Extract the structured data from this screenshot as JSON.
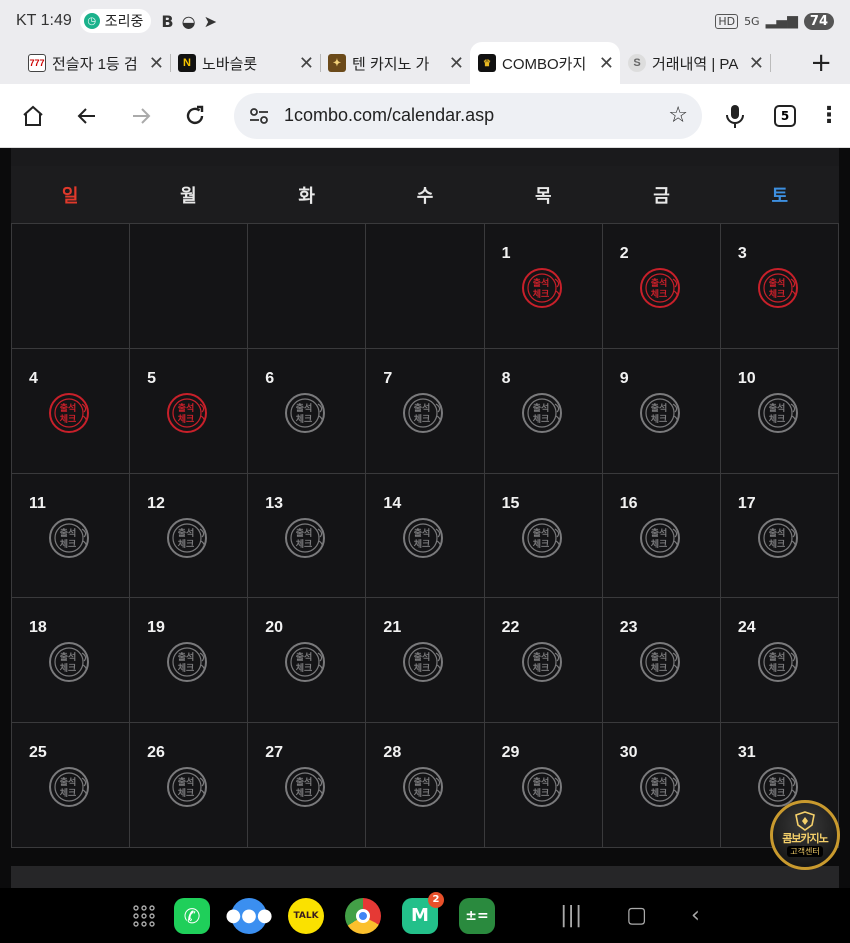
{
  "status_bar": {
    "carrier_time": "KT 1:49",
    "pill_label": "조리중",
    "battery": "74",
    "hd": "HD",
    "network": "5G"
  },
  "tabs": [
    {
      "title": "전슬자 1등 검",
      "icon": "slot-machine-icon"
    },
    {
      "title": "노바슬롯",
      "icon": "n-logo-icon"
    },
    {
      "title": "텐 카지노 가",
      "icon": "casino-chips-icon"
    },
    {
      "title": "COMBO카지",
      "icon": "combo-logo-icon",
      "active": true
    },
    {
      "title": "거래내역 | PA",
      "icon": "page-icon"
    }
  ],
  "address_bar": {
    "url": "1combo.com/calendar.asp",
    "tab_count": "5"
  },
  "calendar": {
    "weekdays": [
      "일",
      "월",
      "화",
      "수",
      "목",
      "금",
      "토"
    ],
    "stamp_text_top": "출석",
    "stamp_text_bottom": "체크",
    "days": [
      {
        "day": "",
        "status": "none"
      },
      {
        "day": "",
        "status": "none"
      },
      {
        "day": "",
        "status": "none"
      },
      {
        "day": "",
        "status": "none"
      },
      {
        "day": "1",
        "status": "checked"
      },
      {
        "day": "2",
        "status": "checked"
      },
      {
        "day": "3",
        "status": "checked"
      },
      {
        "day": "4",
        "status": "checked"
      },
      {
        "day": "5",
        "status": "checked"
      },
      {
        "day": "6",
        "status": "pending"
      },
      {
        "day": "7",
        "status": "pending"
      },
      {
        "day": "8",
        "status": "pending"
      },
      {
        "day": "9",
        "status": "pending"
      },
      {
        "day": "10",
        "status": "pending"
      },
      {
        "day": "11",
        "status": "pending"
      },
      {
        "day": "12",
        "status": "pending"
      },
      {
        "day": "13",
        "status": "pending"
      },
      {
        "day": "14",
        "status": "pending"
      },
      {
        "day": "15",
        "status": "pending"
      },
      {
        "day": "16",
        "status": "pending"
      },
      {
        "day": "17",
        "status": "pending"
      },
      {
        "day": "18",
        "status": "pending"
      },
      {
        "day": "19",
        "status": "pending"
      },
      {
        "day": "20",
        "status": "pending"
      },
      {
        "day": "21",
        "status": "pending"
      },
      {
        "day": "22",
        "status": "pending"
      },
      {
        "day": "23",
        "status": "pending"
      },
      {
        "day": "24",
        "status": "pending"
      },
      {
        "day": "25",
        "status": "pending"
      },
      {
        "day": "26",
        "status": "pending"
      },
      {
        "day": "27",
        "status": "pending"
      },
      {
        "day": "28",
        "status": "pending"
      },
      {
        "day": "29",
        "status": "pending"
      },
      {
        "day": "30",
        "status": "pending"
      },
      {
        "day": "31",
        "status": "pending"
      }
    ]
  },
  "support_badge": {
    "title": "콤보카지노",
    "subtitle": "고객센터"
  },
  "dock": {
    "kakao_label": "TALK",
    "notif_count": "2"
  },
  "colors": {
    "checked_stamp": "#c8202a",
    "pending_stamp": "#7a7a7c",
    "sunday": "#e0392b",
    "saturday": "#3d8fe0"
  }
}
